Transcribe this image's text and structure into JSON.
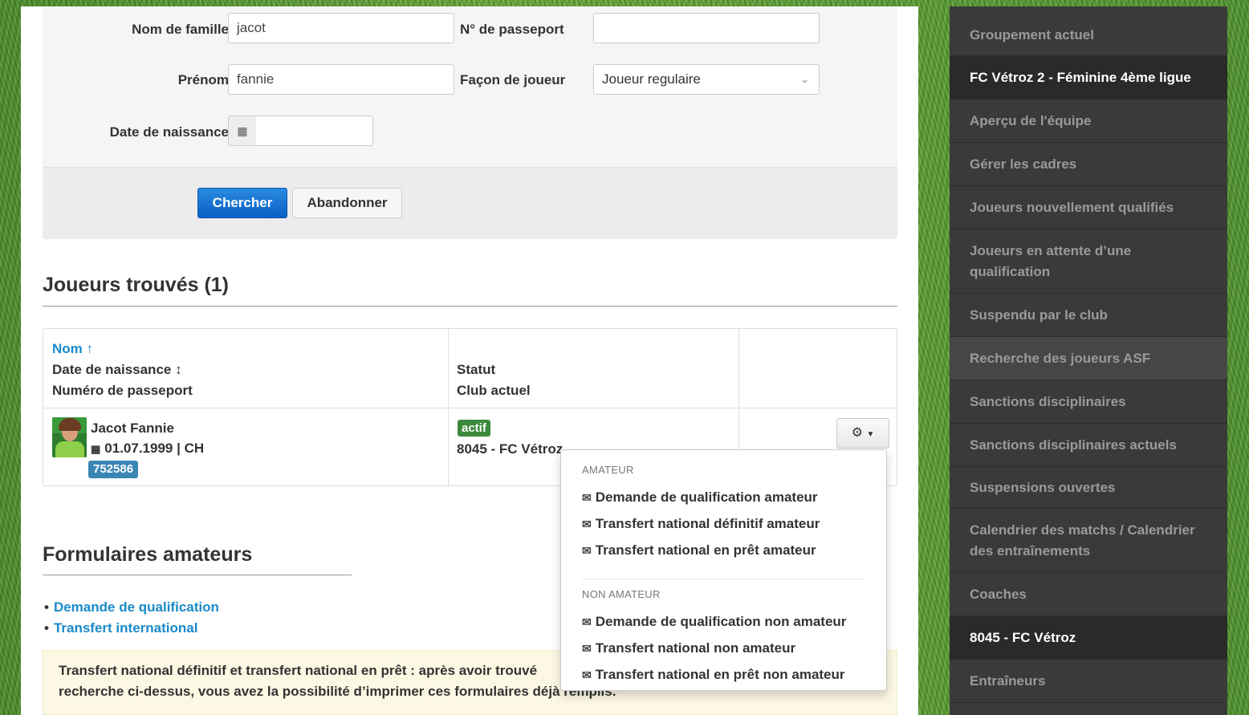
{
  "search": {
    "nom_label": "Nom de famille",
    "nom_value": "jacot",
    "passeport_label": "N° de passeport",
    "passeport_value": "",
    "prenom_label": "Prénom",
    "prenom_value": "fannie",
    "facon_label": "Façon de joueur",
    "facon_value": "Joueur regulaire",
    "naissance_label": "Date de naissance",
    "naissance_value": "",
    "search_button": "Chercher",
    "cancel_button": "Abandonner"
  },
  "results": {
    "title": "Joueurs trouvés (1)",
    "headers": {
      "nom": "Nom ↑",
      "naissance": "Date de naissance ↕",
      "passeport": "Numéro de passeport",
      "statut": "Statut",
      "club": "Club actuel"
    },
    "rows": [
      {
        "name": "Jacot Fannie",
        "birth": "01.07.1999 | CH",
        "passport": "752586",
        "status": "actif",
        "club": "8045 - FC Vétroz"
      }
    ]
  },
  "dropdown": {
    "amateur_header": "AMATEUR",
    "amateur_items": [
      "Demande de qualification amateur",
      "Transfert national définitif amateur",
      "Transfert national en prêt amateur"
    ],
    "non_amateur_header": "NON AMATEUR",
    "non_amateur_items": [
      "Demande de qualification non amateur",
      "Transfert national non amateur",
      "Transfert national en prêt non amateur"
    ]
  },
  "forms": {
    "title": "Formulaires amateurs",
    "links": [
      "Demande de qualification",
      "Transfert international"
    ],
    "alert_line1": "Transfert national définitif et transfert national en prêt : après avoir trouvé",
    "alert_line2": "recherche ci-dessus, vous avez la possibilité d’imprimer ces formulaires déjà remplis."
  },
  "sidebar": {
    "items": [
      {
        "label": "Groupement actuel",
        "state": "normal"
      },
      {
        "label": "FC Vétroz 2 - Féminine 4ème ligue",
        "state": "active"
      },
      {
        "label": "Aperçu de l'équipe",
        "state": "normal"
      },
      {
        "label": "Gérer les cadres",
        "state": "normal"
      },
      {
        "label": "Joueurs nouvellement qualifiés",
        "state": "normal"
      },
      {
        "label": "Joueurs en attente d’une qualification",
        "state": "normal"
      },
      {
        "label": "Suspendu par le club",
        "state": "normal"
      },
      {
        "label": "Recherche des joueurs ASF",
        "state": "current"
      },
      {
        "label": "Sanctions disciplinaires",
        "state": "normal"
      },
      {
        "label": "Sanctions disciplinaires actuels",
        "state": "normal"
      },
      {
        "label": "Suspensions ouvertes",
        "state": "normal"
      },
      {
        "label": "Calendrier des matchs / Calendrier des entraînements",
        "state": "normal"
      },
      {
        "label": "Coaches",
        "state": "normal"
      },
      {
        "label": "8045 - FC Vétroz",
        "state": "active"
      },
      {
        "label": "Entraîneurs",
        "state": "normal"
      }
    ]
  },
  "icons": {
    "calendar": "calendar-icon",
    "gear": "gear-icon",
    "envelope": "envelope-icon",
    "chevron": "chevron-down-icon"
  },
  "colors": {
    "primary": "#0a61c4",
    "link": "#1a8ac8",
    "status_active": "#3c8a3c",
    "passport_badge": "#3a86b5",
    "sidebar_bg": "#3a3a3a",
    "alert_bg": "#fcf8e3"
  }
}
